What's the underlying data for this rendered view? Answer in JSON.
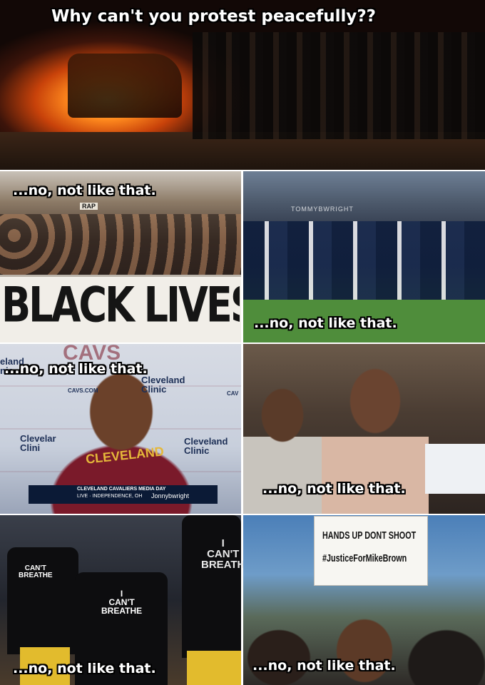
{
  "meme": {
    "top_caption": "Why can't you protest peacefully??",
    "panel_caption": "...no, not like that."
  },
  "crowd_panel": {
    "banner": "BLACK LIVES MA",
    "sign": "RAP",
    "watermark": "TOMMYBWRIGHT"
  },
  "press_panel": {
    "board_cavs": "CAVS",
    "board_left": "eland\nnic",
    "board_clinic_1": "Cleveland\nClinic",
    "board_cavs_com": "CAVS.COM",
    "board_clinic_2": "Clevelar\nClini",
    "board_clinic_3": "Cleveland\nClinic",
    "board_cav": "CAV",
    "jersey": "CLEVELAND",
    "lower_third_line1": "CLEVELAND CAVALIERS MEDIA DAY",
    "lower_third_line2": "LIVE · INDEPENDENCE, OH",
    "watermark": "Jonnybwright"
  },
  "shirts_panel": {
    "shirt_left": "CAN'T\nBREATHE",
    "shirt_center": "I\nCAN'T\nBREATHE",
    "shirt_right": "I\nCAN'T\nBREATH"
  },
  "sign_panel": {
    "line1": "HANDS UP DONT SHOOT",
    "line2": "#JusticeForMikeBrown"
  }
}
